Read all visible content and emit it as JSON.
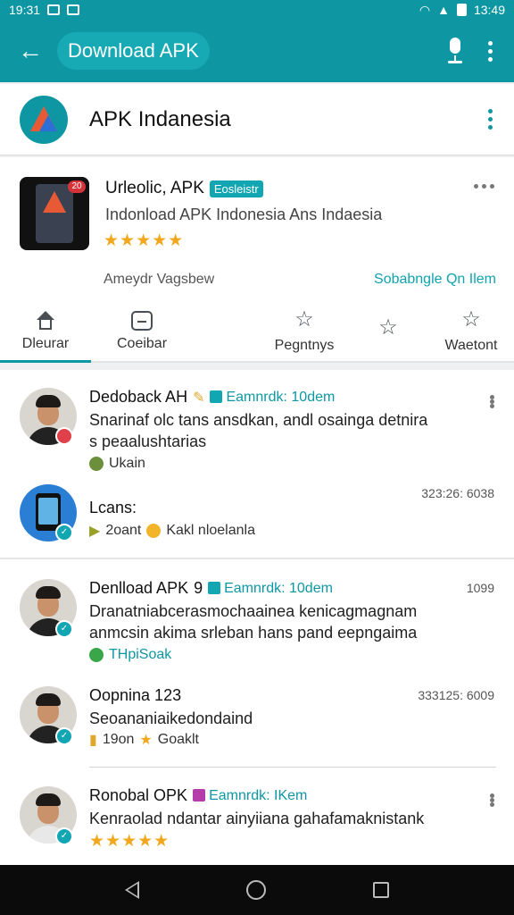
{
  "status_bar": {
    "time_left": "19:31",
    "time_right": "13:49"
  },
  "toolbar": {
    "search_text": "Download APK"
  },
  "app_header": {
    "title": "APK Indanesia"
  },
  "detail": {
    "name": "Urleolic, APK",
    "tag": "Eosleistr",
    "phone_badge": "20",
    "subtitle": "Indonload APK Indonesia Ans Indaesia",
    "stars": "★★★★★",
    "developer": "Ameydr Vagsbew",
    "link": "Sobabngle Qn Ilem",
    "tabs": [
      {
        "label": "Dleurar",
        "icon": "home-icon"
      },
      {
        "label": "Coeibar",
        "icon": "chat-icon"
      },
      {
        "label": "Pegntnys",
        "icon": "star-icon"
      },
      {
        "label": "",
        "icon": "star-icon"
      },
      {
        "label": "Waetont",
        "icon": "star-icon"
      }
    ]
  },
  "feed": [
    {
      "name": "Dedoback AH",
      "tag": "Eamnrdk: 10dem",
      "body_line1": "Snarinaf olc tans ansdkan, andl osainga detnira",
      "body_line2": "s peaalushtarias",
      "meta": "Ukain"
    },
    {
      "name": "Lcans:",
      "time": "323:26: 6038",
      "meta_a": "2oant",
      "meta_b": "Kakl nloelanla"
    },
    {
      "name": "Denlload APK",
      "prefix": "9",
      "tag": "Eamnrdk: 10dem",
      "time": "1099",
      "body_line1": "Dranatniabcerasmochaainea kenicagmagnam",
      "body_line2": "anmcsin akima srleban hans pand eepngaima",
      "meta": "THpiSoak"
    },
    {
      "name": "Oopnina 123",
      "time": "333125: 6009",
      "body_line1": "Seoananiaikedondaind",
      "meta_a": "19on",
      "meta_b": "Goaklt"
    },
    {
      "name": "Ronobal OPK",
      "tag": "Eamnrdk: IKem",
      "body_line1": "Kenraolad ndantar ainyiiana  gahafamaknistank",
      "stars": "★★★★★"
    }
  ],
  "colors": {
    "primary": "#0e97a3",
    "accent": "#11a6b2",
    "star": "#f2a81d"
  }
}
